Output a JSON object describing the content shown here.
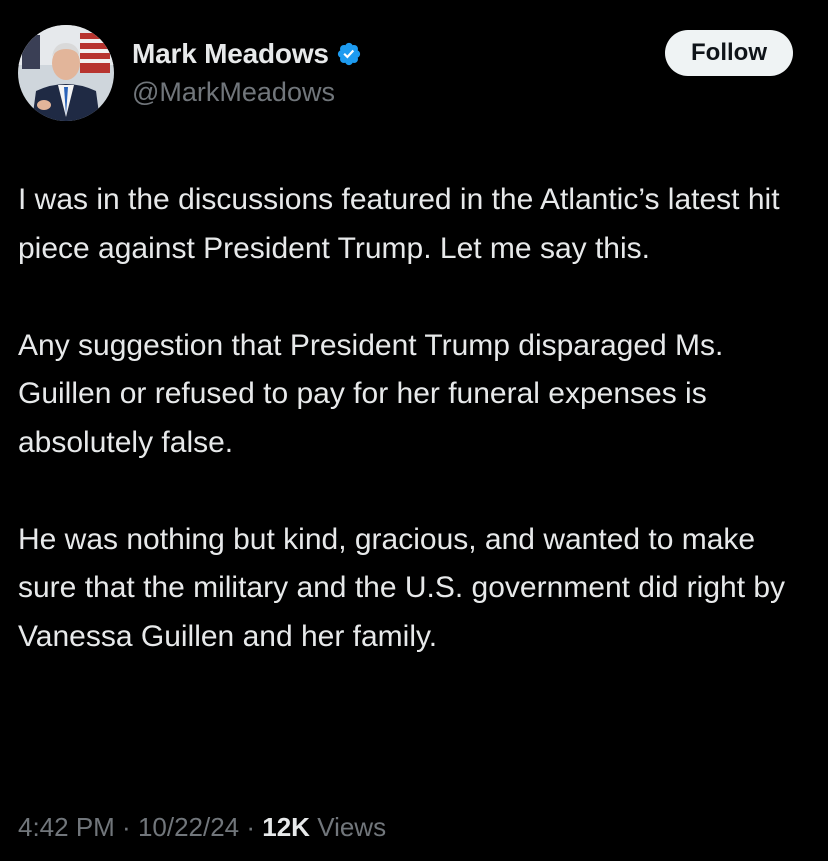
{
  "author": {
    "display_name": "Mark Meadows",
    "handle": "@MarkMeadows",
    "verified": true,
    "verified_color": "#1d9bf0"
  },
  "follow_button": {
    "label": "Follow"
  },
  "tweet": {
    "paragraphs": [
      "I was in the discussions featured in the Atlantic’s latest hit piece against President Trump. Let me say this.",
      "Any suggestion that President Trump disparaged Ms. Guillen or refused to pay for her funeral expenses is absolutely false.",
      "He was nothing but kind, gracious, and wanted to make sure that the military and the U.S. government did right by Vanessa Guillen and her family."
    ]
  },
  "meta": {
    "time": "4:42 PM",
    "separator": " · ",
    "date": "10/22/24",
    "views_count": "12K",
    "views_label": " Views"
  },
  "theme": {
    "background": "#000000",
    "text": "#e7e9ea",
    "secondary_text": "#71767b",
    "follow_bg": "#eff3f4"
  }
}
